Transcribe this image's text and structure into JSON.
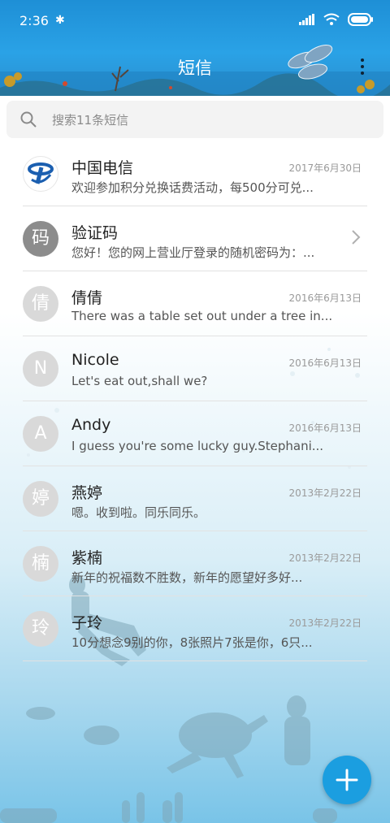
{
  "status_bar": {
    "time": "2:36",
    "bluetooth": "✱"
  },
  "header": {
    "title": "短信"
  },
  "search": {
    "placeholder": "搜索11条短信"
  },
  "conversations": [
    {
      "name": "中国电信",
      "date": "2017年6月30日",
      "snippet": "欢迎参加积分兑换话费活动，每500分可兑...",
      "avatar": "",
      "avatar_type": "logo"
    },
    {
      "name": "验证码",
      "date": "",
      "snippet": "您好！您的网上营业厅登录的随机密码为：...",
      "avatar": "码",
      "avatar_type": "dark",
      "chevron": true
    },
    {
      "name": "倩倩",
      "date": "2016年6月13日",
      "snippet": "There was a table set out under a tree in...",
      "avatar": "倩",
      "avatar_type": "light"
    },
    {
      "name": "Nicole",
      "date": "2016年6月13日",
      "snippet": "Let's eat out,shall we?",
      "avatar": "N",
      "avatar_type": "light"
    },
    {
      "name": "Andy",
      "date": "2016年6月13日",
      "snippet": "I guess you're some lucky guy.Stephani...",
      "avatar": "A",
      "avatar_type": "light"
    },
    {
      "name": "燕婷",
      "date": "2013年2月22日",
      "snippet": "嗯。收到啦。同乐同乐。",
      "avatar": "婷",
      "avatar_type": "light"
    },
    {
      "name": "紫楠",
      "date": "2013年2月22日",
      "snippet": "新年的祝福数不胜数，新年的愿望好多好...",
      "avatar": "楠",
      "avatar_type": "light"
    },
    {
      "name": "子玲",
      "date": "2013年2月22日",
      "snippet": "10分想念9别的你，8张照片7张是你，6只...",
      "avatar": "玲",
      "avatar_type": "light"
    }
  ],
  "colors": {
    "accent": "#1b9ee0",
    "header": "#2aa2e6"
  },
  "icons": {
    "search": "search-icon",
    "menu": "more-vert-icon",
    "fab": "plus-icon"
  }
}
